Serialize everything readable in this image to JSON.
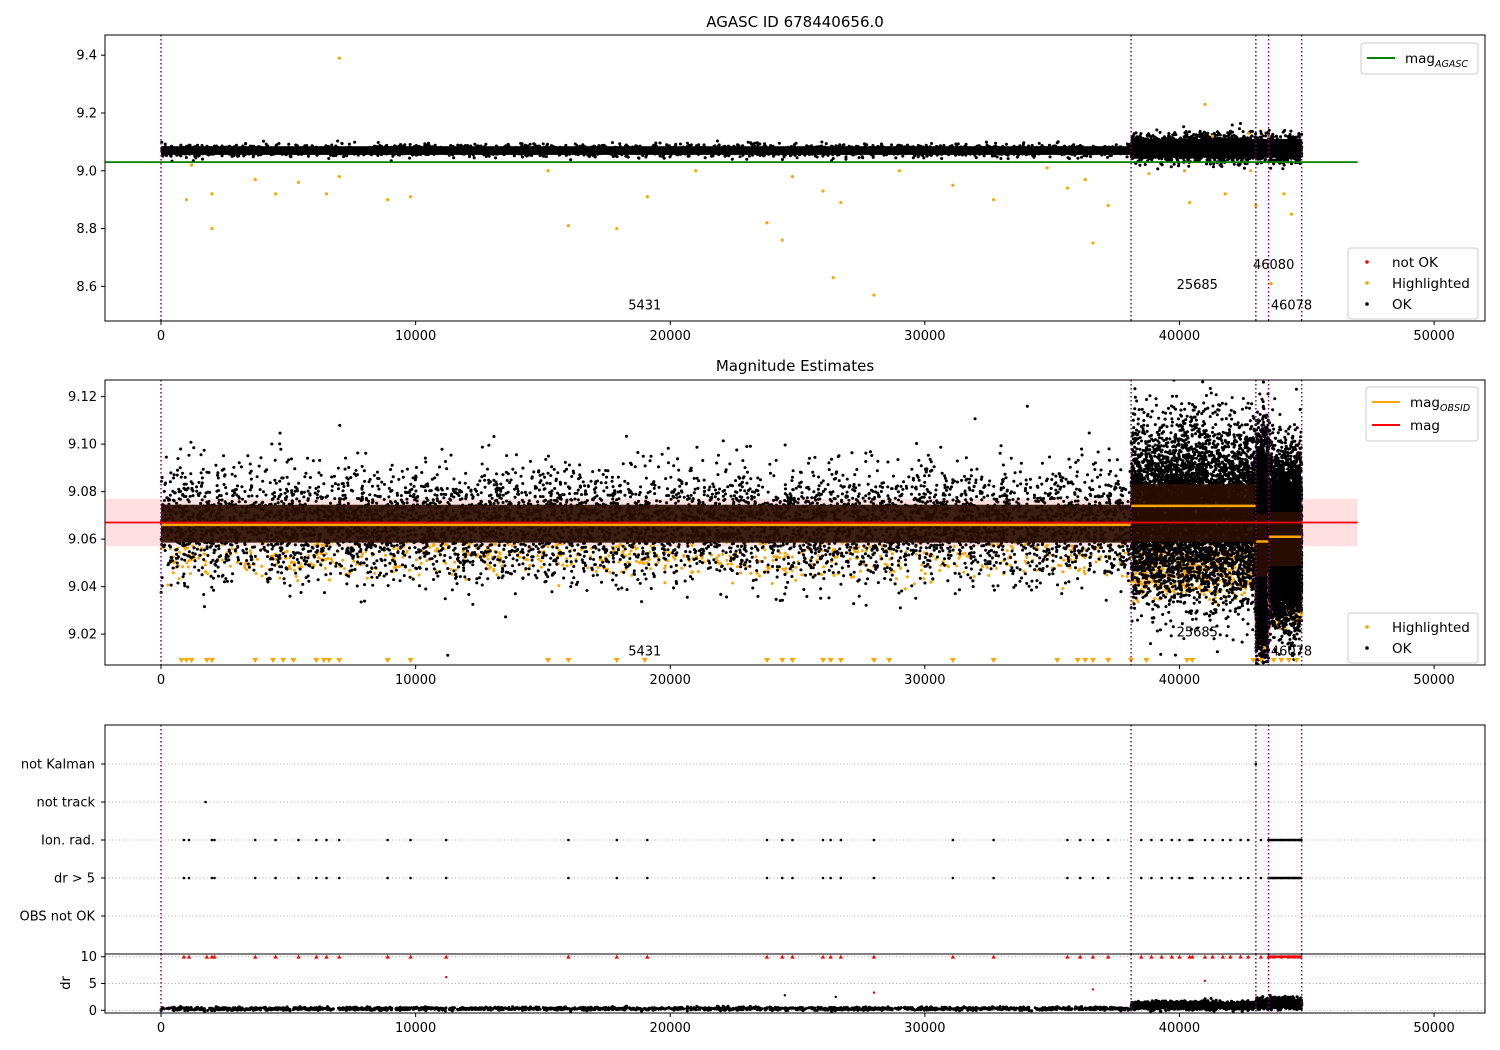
{
  "chart_data": [
    {
      "type": "scatter",
      "title": "AGASC ID 678440656.0",
      "xlim": [
        -2200,
        52000
      ],
      "ylim": [
        8.48,
        9.47
      ],
      "xticks": [
        0,
        10000,
        20000,
        30000,
        40000,
        50000
      ],
      "xtick_labels": [
        "0",
        "10000",
        "20000",
        "30000",
        "40000",
        "50000"
      ],
      "yticks": [
        8.6,
        8.8,
        9.0,
        9.2,
        9.4
      ],
      "ytick_labels": [
        "8.6",
        "8.8",
        "9.0",
        "9.2",
        "9.4"
      ],
      "obsid_boundaries": [
        0,
        38100,
        43000,
        43500,
        44800
      ],
      "obsid_labels": [
        {
          "text": "5431",
          "x": 19000,
          "y": 8.52
        },
        {
          "text": "25685",
          "x": 40700,
          "y": 8.59
        },
        {
          "text": "46080",
          "x": 43700,
          "y": 8.66
        },
        {
          "text": "46078",
          "x": 44400,
          "y": 8.52
        }
      ],
      "mag_agasc": {
        "value": 9.03,
        "x": [
          -2200,
          47000
        ],
        "color": "#008000"
      },
      "ok_band": [
        {
          "x": [
            0,
            38100
          ],
          "low": 9.055,
          "high": 9.085
        },
        {
          "x": [
            38100,
            44800
          ],
          "low": 9.045,
          "high": 9.11
        }
      ],
      "highlighted_points": [
        {
          "x": 7000,
          "y": 9.39
        },
        {
          "x": 41000,
          "y": 9.23
        },
        {
          "x": 2000,
          "y": 8.8
        },
        {
          "x": 16000,
          "y": 8.81
        },
        {
          "x": 17900,
          "y": 8.8
        },
        {
          "x": 23800,
          "y": 8.82
        },
        {
          "x": 24400,
          "y": 8.76
        },
        {
          "x": 26400,
          "y": 8.63
        },
        {
          "x": 28000,
          "y": 8.57
        },
        {
          "x": 36600,
          "y": 8.75
        },
        {
          "x": 43600,
          "y": 8.61
        },
        {
          "x": 43000,
          "y": 8.88
        },
        {
          "x": 44400,
          "y": 8.85
        },
        {
          "x": 1000,
          "y": 8.9
        },
        {
          "x": 8900,
          "y": 8.9
        },
        {
          "x": 19100,
          "y": 8.91
        },
        {
          "x": 26700,
          "y": 8.89
        },
        {
          "x": 32700,
          "y": 8.9
        },
        {
          "x": 37200,
          "y": 8.88
        },
        {
          "x": 40400,
          "y": 8.89
        },
        {
          "x": 4500,
          "y": 8.92
        },
        {
          "x": 6500,
          "y": 8.92
        },
        {
          "x": 9800,
          "y": 8.91
        },
        {
          "x": 2000,
          "y": 8.92
        },
        {
          "x": 26000,
          "y": 8.93
        },
        {
          "x": 31100,
          "y": 8.95
        },
        {
          "x": 35600,
          "y": 8.94
        },
        {
          "x": 41800,
          "y": 8.92
        },
        {
          "x": 44100,
          "y": 8.92
        },
        {
          "x": 3700,
          "y": 8.97
        },
        {
          "x": 5400,
          "y": 8.96
        },
        {
          "x": 7000,
          "y": 8.98
        },
        {
          "x": 24800,
          "y": 8.98
        },
        {
          "x": 36300,
          "y": 8.97
        },
        {
          "x": 38800,
          "y": 8.99
        },
        {
          "x": 40200,
          "y": 9.0
        },
        {
          "x": 42800,
          "y": 9.0
        },
        {
          "x": 15200,
          "y": 9.0
        },
        {
          "x": 21000,
          "y": 9.0
        },
        {
          "x": 29000,
          "y": 9.0
        },
        {
          "x": 34800,
          "y": 9.01
        },
        {
          "x": 43500,
          "y": 9.12
        },
        {
          "x": 42700,
          "y": 9.13
        },
        {
          "x": 41300,
          "y": 9.12
        },
        {
          "x": 1200,
          "y": 9.02
        }
      ],
      "legend_line": [
        {
          "name": "mag",
          "subscript": "AGASC",
          "color": "#008000"
        }
      ],
      "legend_scatter": [
        {
          "name": "not OK",
          "color": "#ff0000"
        },
        {
          "name": "Highlighted",
          "color": "#ffa500"
        },
        {
          "name": "OK",
          "color": "#000000"
        }
      ]
    },
    {
      "type": "scatter",
      "title": "Magnitude Estimates",
      "xlim": [
        -2200,
        52000
      ],
      "ylim": [
        9.007,
        9.127
      ],
      "xticks": [
        0,
        10000,
        20000,
        30000,
        40000,
        50000
      ],
      "xtick_labels": [
        "0",
        "10000",
        "20000",
        "30000",
        "40000",
        "50000"
      ],
      "yticks": [
        9.02,
        9.04,
        9.06,
        9.08,
        9.1,
        9.12
      ],
      "ytick_labels": [
        "9.02",
        "9.04",
        "9.06",
        "9.08",
        "9.10",
        "9.12"
      ],
      "obsid_boundaries": [
        0,
        38100,
        43000,
        43500,
        44800
      ],
      "obsid_labels": [
        {
          "text": "5431",
          "x": 19000,
          "y": 9.011
        },
        {
          "text": "25685",
          "x": 40700,
          "y": 9.019
        },
        {
          "text": "46080",
          "x": 43700,
          "y": 9.028
        },
        {
          "text": "46078",
          "x": 44400,
          "y": 9.011
        }
      ],
      "mag": {
        "value": 9.067,
        "x": [
          -2200,
          47000
        ],
        "color": "#ff0000",
        "band": [
          9.057,
          9.077
        ]
      },
      "mag_obsid": [
        {
          "x": [
            0,
            38100
          ],
          "value": 9.066
        },
        {
          "x": [
            38100,
            43000
          ],
          "value": 9.074
        },
        {
          "x": [
            43000,
            43500
          ],
          "value": 9.059
        },
        {
          "x": [
            43500,
            44800
          ],
          "value": 9.061
        }
      ],
      "ok_band": [
        {
          "x": [
            0,
            38100
          ],
          "low": 9.056,
          "high": 9.077
        },
        {
          "x": [
            38100,
            43000
          ],
          "low": 9.055,
          "high": 9.087
        },
        {
          "x": [
            43000,
            43500
          ],
          "low": 9.04,
          "high": 9.075
        },
        {
          "x": [
            43500,
            44800
          ],
          "low": 9.045,
          "high": 9.075
        }
      ],
      "lower_limit_markers_x": [
        800,
        1000,
        1200,
        1800,
        2000,
        3700,
        4400,
        4800,
        5200,
        6100,
        6400,
        6600,
        7000,
        8900,
        9800,
        15200,
        16000,
        17900,
        19000,
        23800,
        24400,
        24800,
        26000,
        26300,
        26700,
        28000,
        28600,
        31100,
        32700,
        35200,
        36000,
        36300,
        36600,
        37200,
        38100,
        38700,
        40300,
        40500,
        42900,
        43200,
        43700,
        44000,
        44300,
        44600
      ],
      "legend_line": [
        {
          "name": "mag",
          "subscript": "OBSID",
          "color": "#ffa500"
        },
        {
          "name": "mag",
          "subscript": "",
          "color": "#ff0000"
        }
      ],
      "legend_scatter": [
        {
          "name": "Highlighted",
          "color": "#ffa500"
        },
        {
          "name": "OK",
          "color": "#000000"
        }
      ]
    },
    {
      "type": "scatter",
      "title": "",
      "xlim": [
        -2200,
        52000
      ],
      "categories": [
        "not Kalman",
        "not track",
        "Ion. rad.",
        "dr > 5",
        "OBS not OK"
      ],
      "flag_events": {
        "not Kalman": [
          43000
        ],
        "not track": [
          1750
        ],
        "Ion. rad.": [
          900,
          1100,
          2000,
          2100,
          3700,
          4500,
          5400,
          6100,
          6500,
          7000,
          8900,
          9800,
          11200,
          16000,
          17900,
          19100,
          23800,
          24400,
          24800,
          26000,
          26300,
          26700,
          28000,
          31100,
          32700,
          35600,
          36100,
          36600,
          37200,
          38500,
          38900,
          39300,
          39700,
          40000,
          40400,
          40500,
          41000,
          41300,
          41700,
          42000,
          42400,
          42700,
          43200,
          43500,
          43700,
          44000,
          44300,
          44500,
          44700
        ],
        "dr > 5": [
          900,
          1100,
          2000,
          2100,
          3700,
          4500,
          5400,
          6100,
          6500,
          7000,
          8900,
          9800,
          11200,
          16000,
          17900,
          19100,
          23800,
          24400,
          24800,
          26000,
          26300,
          26700,
          28000,
          31100,
          32700,
          35600,
          36100,
          36600,
          37200,
          38500,
          38900,
          39300,
          39700,
          40000,
          40400,
          40500,
          41000,
          41300,
          41700,
          42000,
          42400,
          42700,
          43200,
          43500,
          43700,
          44000,
          44300,
          44500,
          44700
        ],
        "OBS not OK": []
      },
      "obsid_boundaries": [
        0,
        38100,
        43000,
        43500,
        44800
      ]
    },
    {
      "type": "scatter",
      "title": "",
      "ylabel": "dr",
      "xlim": [
        -2200,
        52000
      ],
      "ylim": [
        -0.5,
        10.5
      ],
      "xticks": [
        0,
        10000,
        20000,
        30000,
        40000,
        50000
      ],
      "xtick_labels": [
        "0",
        "10000",
        "20000",
        "30000",
        "40000",
        "50000"
      ],
      "yticks": [
        0,
        5,
        10
      ],
      "ytick_labels": [
        "0",
        "5",
        "10"
      ],
      "obsid_boundaries": [
        0,
        38100,
        43000,
        43500,
        44800
      ],
      "clipped_x": [
        900,
        1100,
        1800,
        2000,
        2100,
        3700,
        4500,
        5400,
        6100,
        6500,
        7000,
        8900,
        9800,
        11200,
        16000,
        17900,
        19100,
        23800,
        24400,
        24800,
        26000,
        26300,
        26700,
        28000,
        31100,
        32700,
        35600,
        36100,
        36600,
        37200,
        38500,
        38900,
        39300,
        39700,
        40000,
        40400,
        40500,
        41000,
        41300,
        41700,
        42000,
        42400,
        42700,
        43200,
        43500,
        43700,
        44000,
        44300,
        44500,
        44700
      ],
      "mid_points": [
        {
          "x": 11200,
          "y": 6.2
        },
        {
          "x": 28000,
          "y": 3.3
        },
        {
          "x": 36600,
          "y": 3.9
        },
        {
          "x": 41000,
          "y": 5.5
        },
        {
          "x": 24500,
          "y": 2.8
        },
        {
          "x": 26500,
          "y": 2.5
        }
      ]
    }
  ]
}
